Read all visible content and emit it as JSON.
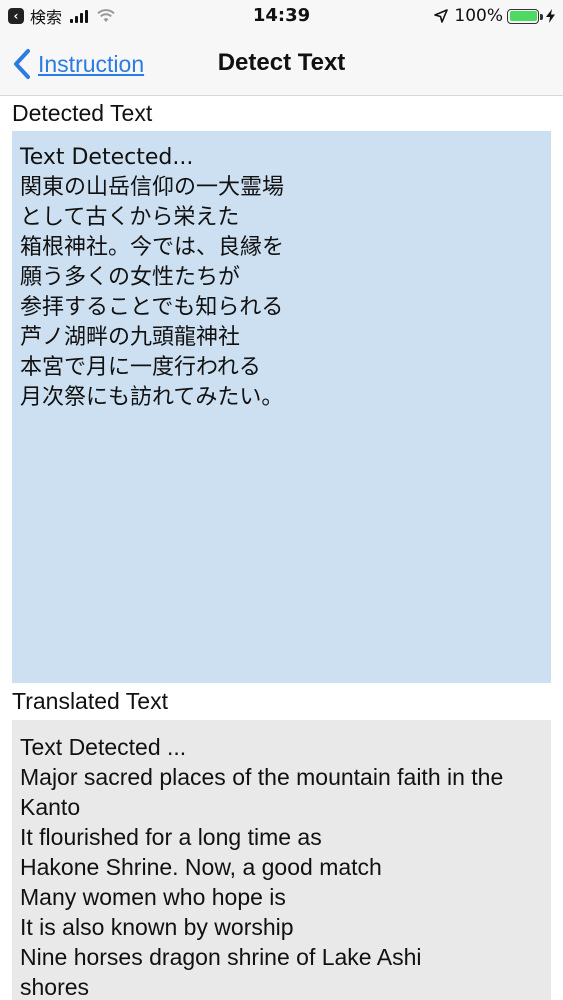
{
  "status_bar": {
    "back_app_label": "検索",
    "time": "14:39",
    "battery_percent": "100%",
    "battery_level": 1.0,
    "icons": [
      "back-app-icon",
      "signal-icon",
      "wifi-icon",
      "location-icon",
      "battery-icon",
      "charging-icon"
    ]
  },
  "nav": {
    "back_label": "Instruction",
    "title": "Detect Text",
    "accent_color": "#2a7be4"
  },
  "detected": {
    "label": "Detected Text",
    "background": "#cde0f2",
    "lines": [
      "Text Detected...",
      "関東の山岳信仰の一大霊場",
      "として古くから栄えた",
      "箱根神社。今では、良縁を",
      "願う多くの女性たちが",
      "参拝することでも知られる",
      "芦ノ湖畔の九頭龍神社",
      "本宮で月に一度行われる",
      "月次祭にも訪れてみたい。"
    ]
  },
  "translated": {
    "label": "Translated Text",
    "background": "#e9e9e9",
    "lines": [
      "Text Detected ...",
      "Major sacred places of the mountain faith in the Kanto",
      "It flourished for a long time as",
      "Hakone Shrine. Now, a good match",
      "Many women who hope is",
      "It is also known by worship",
      "Nine horses dragon shrine of Lake Ashi",
      "shores"
    ]
  }
}
